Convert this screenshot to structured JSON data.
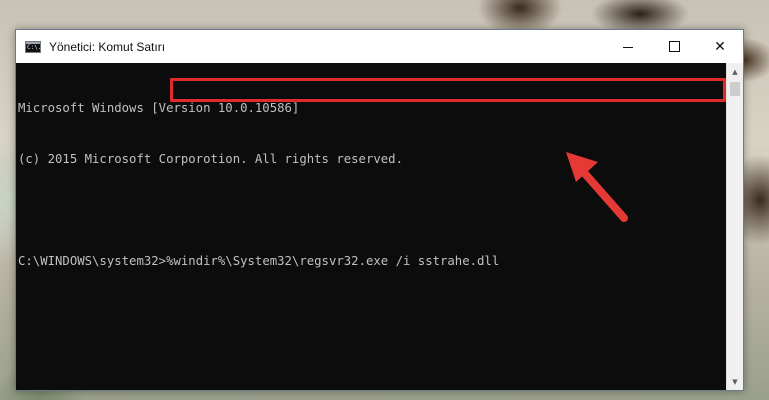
{
  "window": {
    "title": "Yönetici: Komut Satırı",
    "icon_text": "C:\\.",
    "controls": {
      "minimize": "minimize",
      "maximize": "maximize",
      "close": "✕"
    }
  },
  "console": {
    "lines": [
      "Microsoft Windows [Version 10.0.10586]",
      "(c) 2015 Microsoft Corporotion. All rights reserved.",
      ""
    ],
    "prompt": "C:\\WINDOWS\\system32>",
    "command": "%windir%\\System32\\regsvr32.exe /i sstrahe.dll"
  },
  "scrollbar": {
    "up_arrow": "▲",
    "down_arrow": "▼"
  },
  "annotation": {
    "highlight_color": "#e02b2b",
    "arrow_color": "#e53935"
  }
}
